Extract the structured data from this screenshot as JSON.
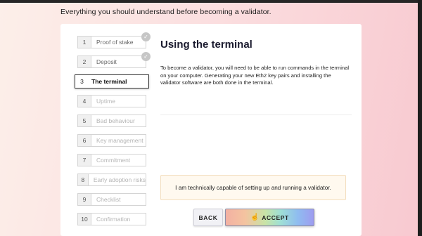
{
  "page": {
    "heading": "Everything you should understand before becoming a validator."
  },
  "steps": [
    {
      "num": "1",
      "label": "Proof of stake",
      "state": "done"
    },
    {
      "num": "2",
      "label": "Deposit",
      "state": "done"
    },
    {
      "num": "3",
      "label": "The terminal",
      "state": "active"
    },
    {
      "num": "4",
      "label": "Uptime",
      "state": "todo"
    },
    {
      "num": "5",
      "label": "Bad behaviour",
      "state": "todo"
    },
    {
      "num": "6",
      "label": "Key management",
      "state": "todo"
    },
    {
      "num": "7",
      "label": "Commitment",
      "state": "todo"
    },
    {
      "num": "8",
      "label": "Early adoption risks",
      "state": "todo"
    },
    {
      "num": "9",
      "label": "Checklist",
      "state": "todo"
    },
    {
      "num": "10",
      "label": "Confirmation",
      "state": "todo"
    }
  ],
  "content": {
    "title": "Using the terminal",
    "body": "To become a validator, you will need to be able to run commands in the terminal on your computer. Generating your new Eth2 key pairs and installing the validator software are both done in the terminal.",
    "confirmation": "I am technically capable of setting up and running a validator."
  },
  "actions": {
    "back_label": "BACK",
    "accept_label": "ACCEPT"
  },
  "icons": {
    "check": "check-icon",
    "cursor": "hand-pointer-icon"
  },
  "colors": {
    "background_pink": "#fbdfe0",
    "confirm_box": "#fff9ef",
    "check_circle": "#c6c6c6"
  }
}
